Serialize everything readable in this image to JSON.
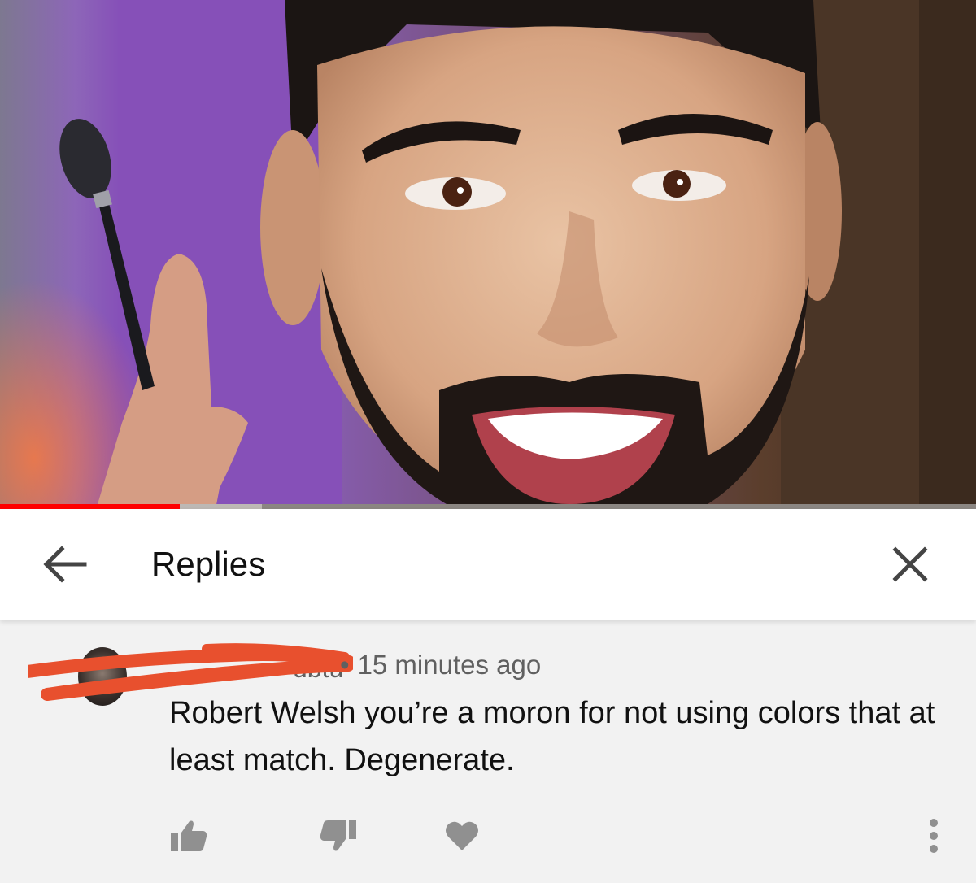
{
  "video": {
    "progress_percent": 18.4,
    "buffered_percent": 26.8,
    "progress_color": "#ff0000"
  },
  "header": {
    "title": "Replies",
    "back_icon": "arrow-left-icon",
    "close_icon": "close-icon"
  },
  "comment": {
    "author_visible_fragment": "ubtu",
    "separator": "•",
    "time": "15 minutes ago",
    "text": "Robert Welsh you’re a moron for not using colors that at least match. Degenerate.",
    "redaction_color": "#e8502e",
    "actions": {
      "like_icon": "thumbs-up-icon",
      "dislike_icon": "thumbs-down-icon",
      "heart_icon": "heart-icon",
      "more_icon": "more-vertical-icon"
    }
  }
}
